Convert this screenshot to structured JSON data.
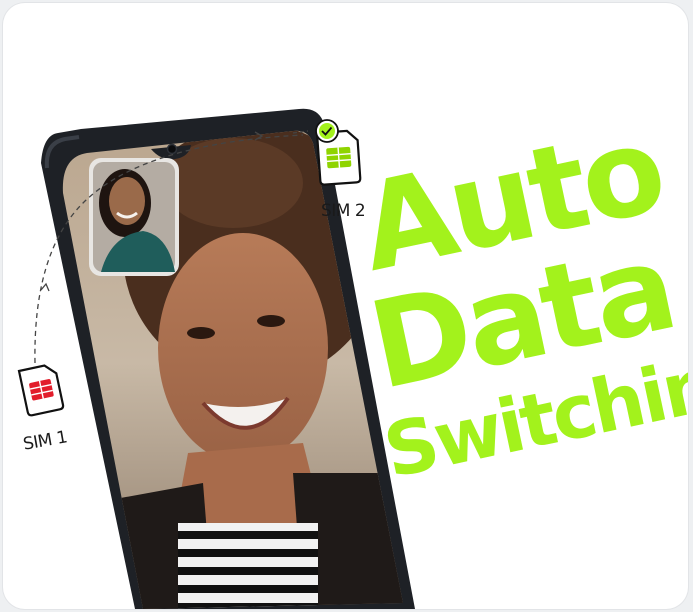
{
  "promo": {
    "headline_lines": [
      "Auto",
      "Data",
      "Switching"
    ],
    "sim1_label": "SIM 1",
    "sim2_label": "SIM 2"
  },
  "colors": {
    "accent_green": "#a3f21c",
    "sim1_red": "#e21d2b",
    "sim2_green": "#8fd400",
    "phone_body": "#1e2126"
  },
  "icons": [
    "sim-card-red-icon",
    "sim-card-green-icon",
    "checkmark-badge-icon",
    "front-camera-icon"
  ]
}
